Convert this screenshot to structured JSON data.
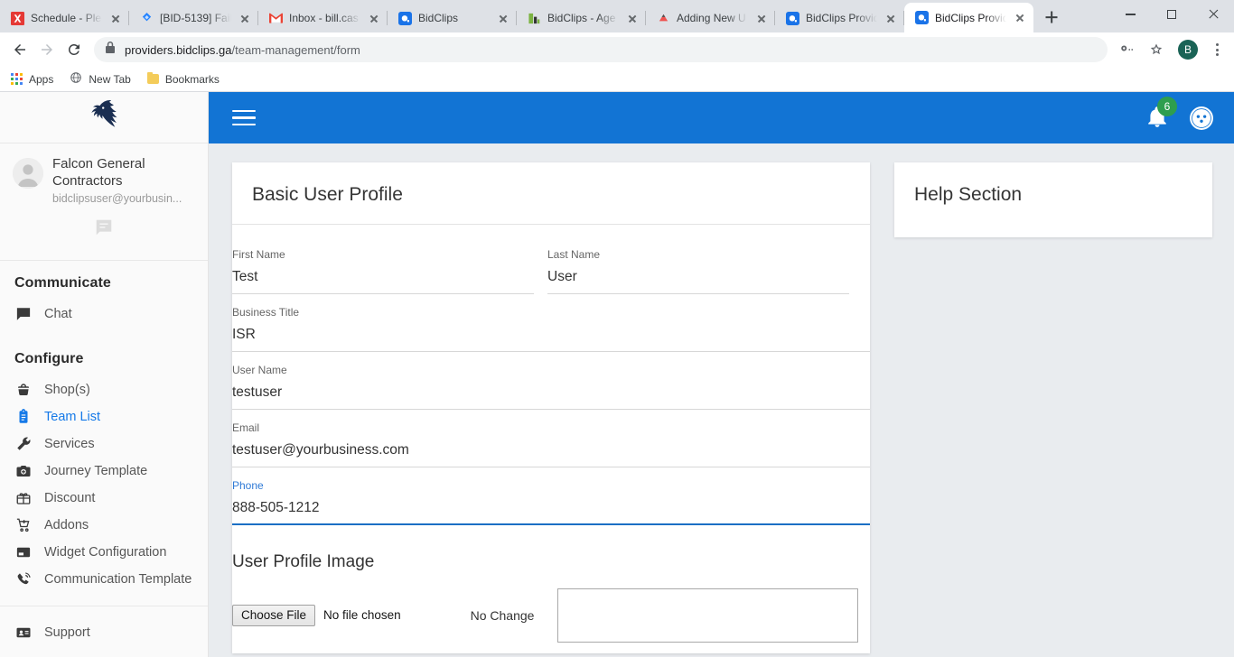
{
  "browser": {
    "tabs": [
      {
        "title": "Schedule - Ple",
        "favicon": "x-red-icon",
        "active": false
      },
      {
        "title": "[BID-5139] Fail",
        "favicon": "jira-icon",
        "active": false
      },
      {
        "title": "Inbox - bill.cas",
        "favicon": "gmail-icon",
        "active": false
      },
      {
        "title": "BidClips",
        "favicon": "bidclips-icon",
        "active": false
      },
      {
        "title": "BidClips - Age",
        "favicon": "green-doc-icon",
        "active": false
      },
      {
        "title": "Adding New U",
        "favicon": "triangle-red-icon",
        "active": false
      },
      {
        "title": "BidClips Provid",
        "favicon": "bidclips-icon",
        "active": false
      },
      {
        "title": "BidClips Provid",
        "favicon": "bidclips-icon",
        "active": true
      }
    ],
    "new_tab_label": "+",
    "window_controls": {
      "minimize": "Minimize",
      "maximize": "Maximize",
      "close": "Close"
    },
    "toolbar": {
      "back": "Back",
      "forward": "Forward",
      "reload": "Reload",
      "url_domain": "providers.bidclips.ga",
      "url_path": "/team-management/form",
      "profile_initial": "B",
      "menu": "Chrome menu"
    },
    "bookmarks": [
      {
        "label": "Apps",
        "icon": "apps-grid-icon"
      },
      {
        "label": "New Tab",
        "icon": "globe-icon"
      },
      {
        "label": "Bookmarks",
        "icon": "folder-icon"
      }
    ]
  },
  "sidebar": {
    "logo_alt": "falcon-logo",
    "profile": {
      "name": "Falcon General Contractors",
      "email": "bidclipsuser@yourbusin...",
      "chat_icon": "chat-bubble-icon"
    },
    "groups": [
      {
        "title": "Communicate",
        "items": [
          {
            "label": "Chat",
            "icon": "chat-icon",
            "active": false
          }
        ]
      },
      {
        "title": "Configure",
        "items": [
          {
            "label": "Shop(s)",
            "icon": "basket-icon",
            "active": false
          },
          {
            "label": "Team List",
            "icon": "clipboard-icon",
            "active": true
          },
          {
            "label": "Services",
            "icon": "wrench-icon",
            "active": false
          },
          {
            "label": "Journey Template",
            "icon": "camera-icon",
            "active": false
          },
          {
            "label": "Discount",
            "icon": "gift-card-icon",
            "active": false
          },
          {
            "label": "Addons",
            "icon": "add-to-cart-icon",
            "active": false
          },
          {
            "label": "Widget Configuration",
            "icon": "widget-window-icon",
            "active": false
          },
          {
            "label": "Communication Template",
            "icon": "phone-ring-icon",
            "active": false
          }
        ]
      },
      {
        "title": "",
        "items": [
          {
            "label": "Support",
            "icon": "contact-card-icon",
            "active": false
          }
        ]
      }
    ]
  },
  "topbar": {
    "menu_toggle": "hamburger-menu",
    "notification_count": "6",
    "bell_icon": "bell-icon",
    "account_icon": "account-face-icon",
    "accent_color": "#1274d4",
    "badge_color": "#2e9e4f"
  },
  "main": {
    "card_title": "Basic User Profile",
    "fields": [
      {
        "label": "First Name",
        "value": "Test",
        "focused": false,
        "width": "half"
      },
      {
        "label": "Last Name",
        "value": "User",
        "focused": false,
        "width": "half"
      },
      {
        "label": "Business Title",
        "value": "ISR",
        "focused": false,
        "width": "full"
      },
      {
        "label": "User Name",
        "value": "testuser",
        "focused": false,
        "width": "full"
      },
      {
        "label": "Email",
        "value": "testuser@yourbusiness.com",
        "focused": false,
        "width": "full"
      },
      {
        "label": "Phone",
        "value": "888-505-1212",
        "focused": true,
        "width": "full"
      }
    ],
    "image_section": {
      "title": "User Profile Image",
      "choose_file_label": "Choose File",
      "file_status": "No file chosen",
      "change_status": "No Change"
    }
  },
  "help": {
    "title": "Help Section"
  }
}
